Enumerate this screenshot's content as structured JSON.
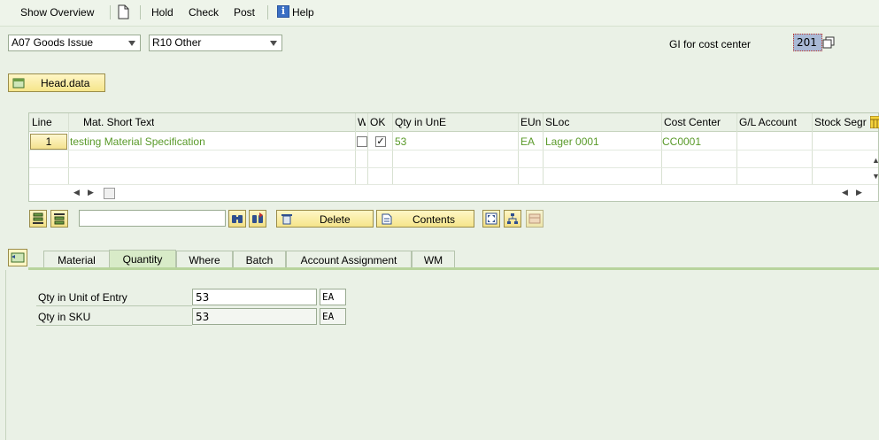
{
  "toolbar": {
    "show_overview": "Show Overview",
    "hold": "Hold",
    "check": "Check",
    "post": "Post",
    "help": "Help"
  },
  "header": {
    "transaction": "A07 Goods Issue",
    "reference": "R10 Other",
    "movement_label": "GI for cost center",
    "movement_type": "201",
    "head_data_button": "Head.data"
  },
  "table": {
    "columns": [
      "Line",
      "Mat. Short Text",
      "W",
      "OK",
      "Qty in UnE",
      "EUn",
      "SLoc",
      "Cost Center",
      "G/L Account",
      "Stock Segr"
    ],
    "rows": [
      {
        "line": "1",
        "material_text": "testing Material Specification",
        "w": false,
        "ok": true,
        "qty": "53",
        "eun": "EA",
        "sloc": "Lager 0001",
        "cost_center": "CC0001",
        "gl_account": "",
        "stock_segment": ""
      }
    ]
  },
  "actions": {
    "find_value": "",
    "delete_label": "Delete",
    "contents_label": "Contents"
  },
  "tabs": [
    {
      "label": "Material",
      "active": false
    },
    {
      "label": "Quantity",
      "active": true
    },
    {
      "label": "Where",
      "active": false
    },
    {
      "label": "Batch",
      "active": false
    },
    {
      "label": "Account Assignment",
      "active": false
    },
    {
      "label": "WM",
      "active": false
    }
  ],
  "quantity_tab": {
    "qty_unit_entry_label": "Qty in Unit of Entry",
    "qty_unit_entry_value": "53",
    "qty_unit_entry_unit": "EA",
    "qty_sku_label": "Qty in SKU",
    "qty_sku_value": "53",
    "qty_sku_unit": "EA"
  },
  "colors": {
    "background": "#eaf1e6",
    "button_yellow": "#f5e58a",
    "green_text": "#5a9a2a",
    "active_tab": "#d8ebc8"
  }
}
